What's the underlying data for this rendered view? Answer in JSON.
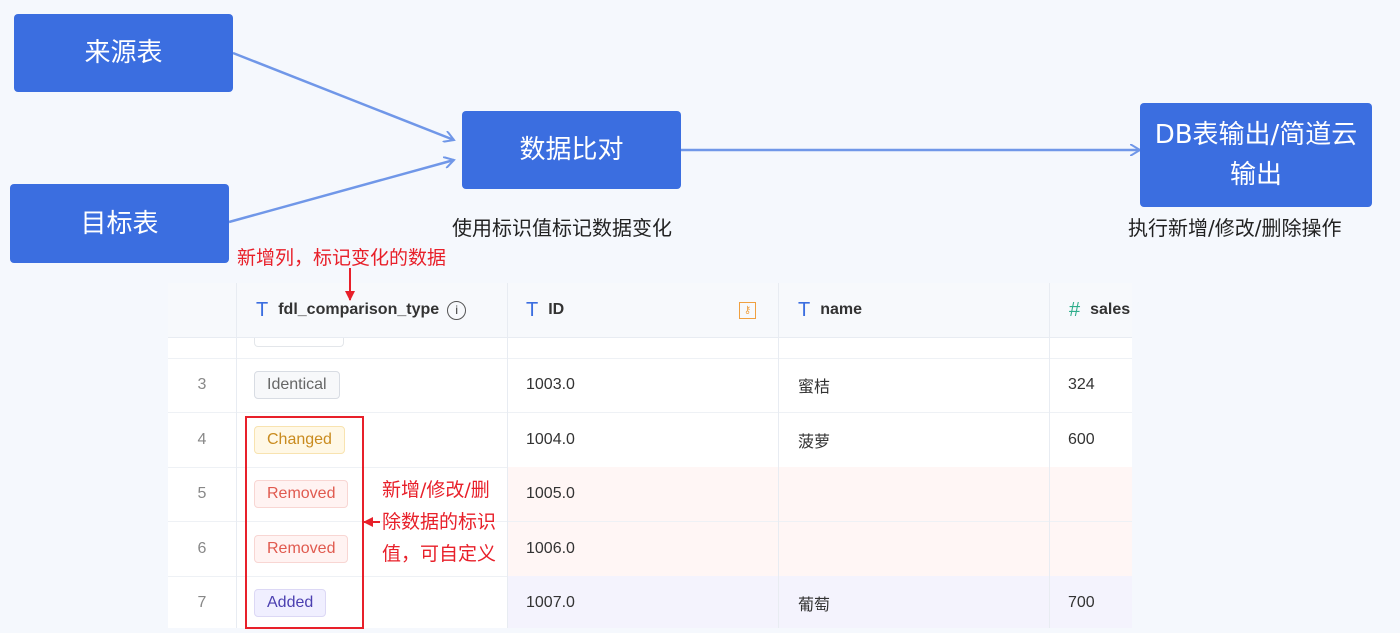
{
  "diagram": {
    "source_table": "来源表",
    "target_table": "目标表",
    "compare": "数据比对",
    "output": "DB表输出/简道云输出",
    "compare_caption": "使用标识值标记数据变化",
    "output_caption": "执行新增/修改/删除操作",
    "note_new_column": "新增列，标记变化的数据",
    "note_flags": "新增/修改/删除数据的标识值，可自定义",
    "colors": {
      "box": "#3b6ee0",
      "arrow": "#7097e8",
      "annotation": "#e8202a"
    }
  },
  "table": {
    "columns": [
      {
        "label": "fdl_comparison_type",
        "type_icon": "text-icon",
        "extra_icon": "info-icon"
      },
      {
        "label": "ID",
        "type_icon": "text-icon",
        "extra_icon": "key-icon"
      },
      {
        "label": "name",
        "type_icon": "text-icon"
      },
      {
        "label": "sales",
        "type_icon": "number-icon"
      }
    ],
    "rows": [
      {
        "index": "3",
        "type": "Identical",
        "id": "1003.0",
        "name": "蜜桔",
        "sales": "324"
      },
      {
        "index": "4",
        "type": "Changed",
        "id": "1004.0",
        "name": "菠萝",
        "sales": "600"
      },
      {
        "index": "5",
        "type": "Removed",
        "id": "1005.0",
        "name": "",
        "sales": ""
      },
      {
        "index": "6",
        "type": "Removed",
        "id": "1006.0",
        "name": "",
        "sales": ""
      },
      {
        "index": "7",
        "type": "Added",
        "id": "1007.0",
        "name": "葡萄",
        "sales": "700"
      }
    ]
  }
}
